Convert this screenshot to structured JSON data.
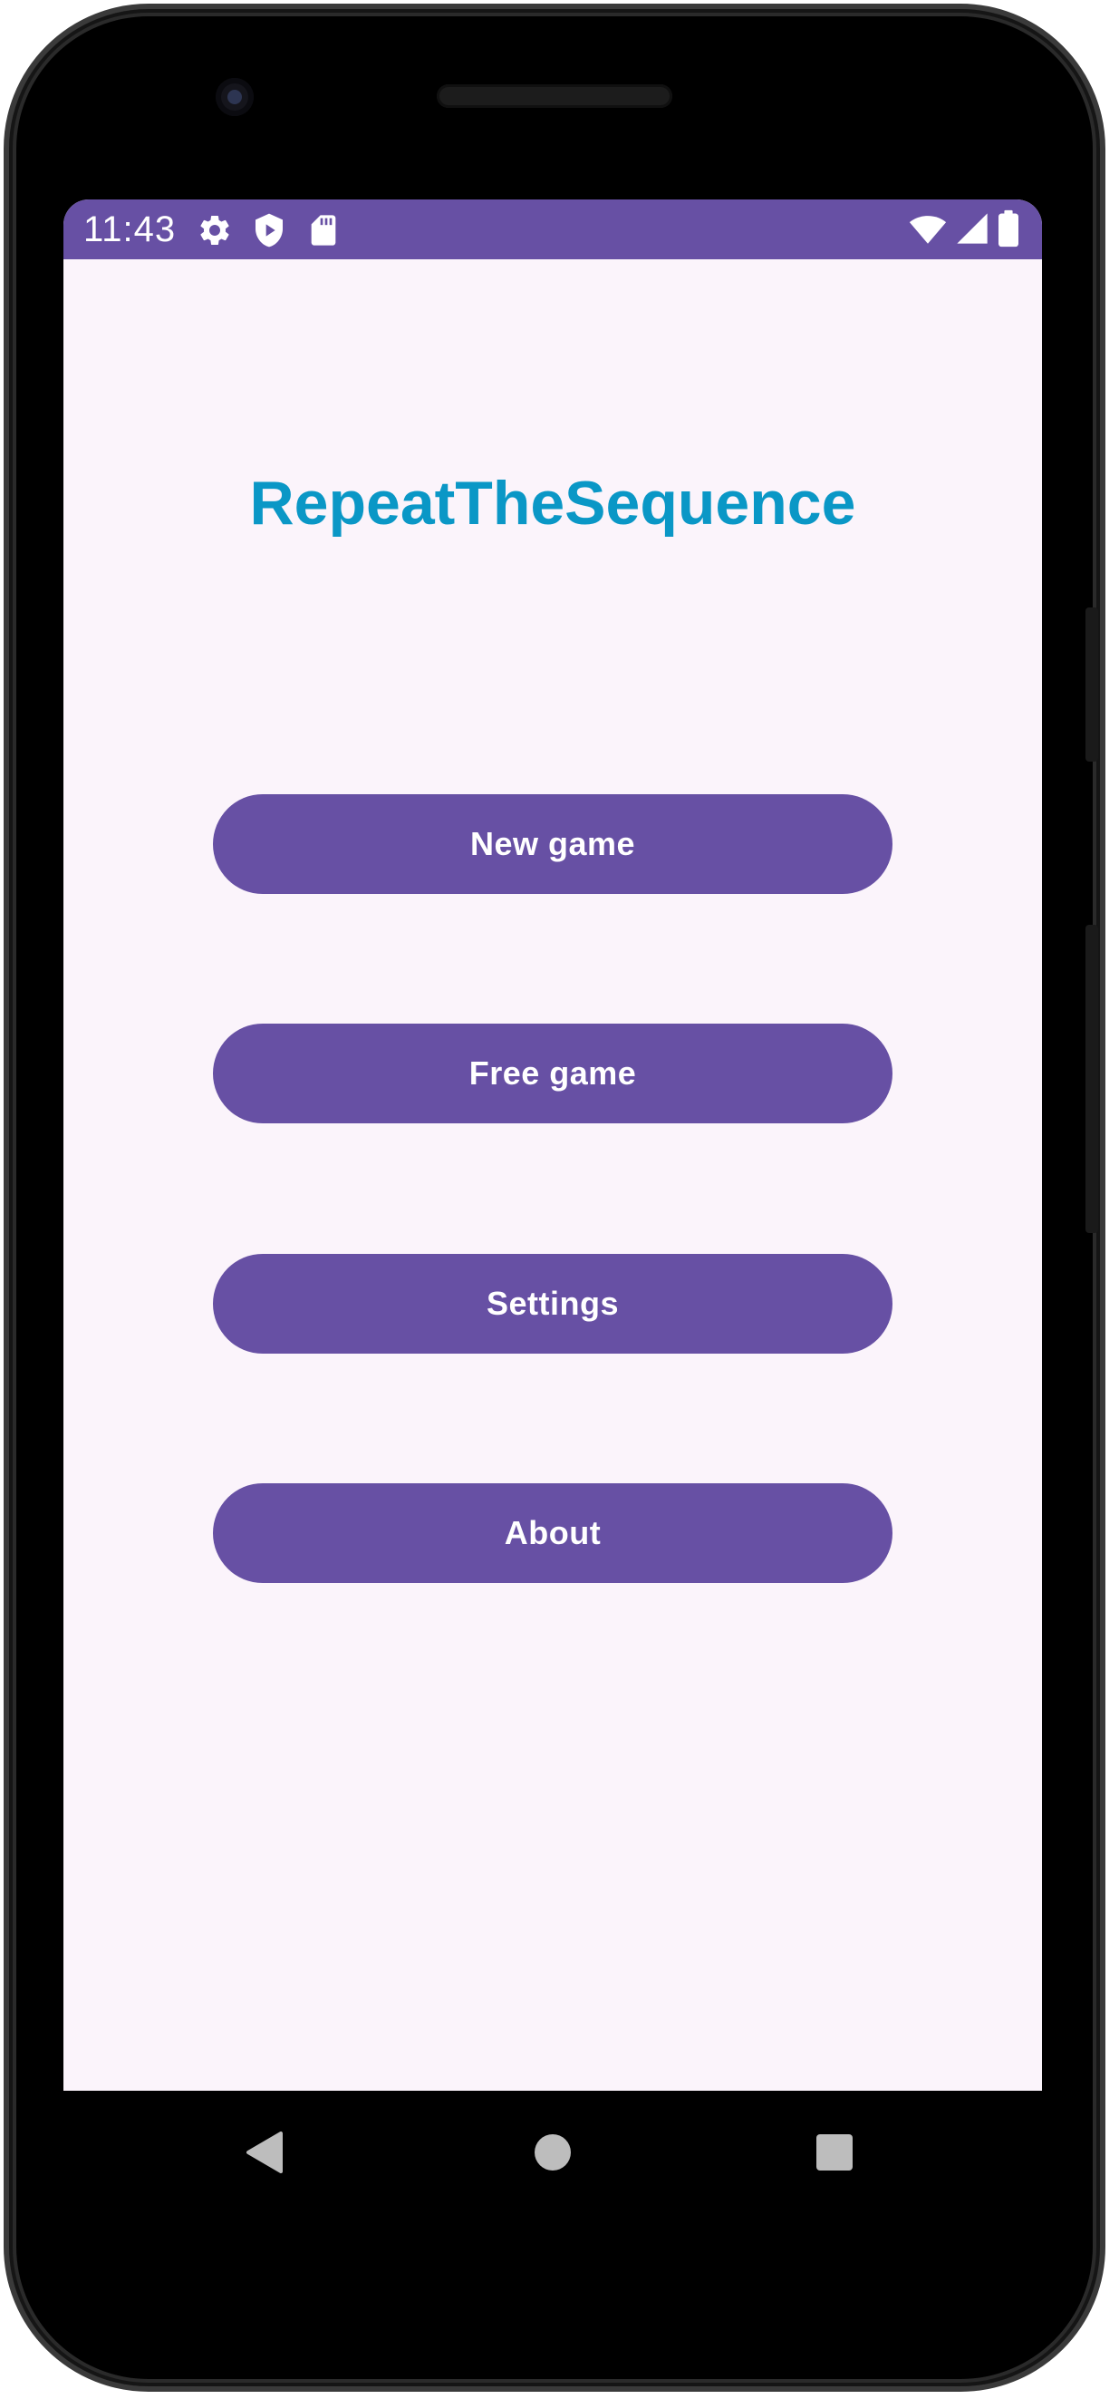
{
  "status_bar": {
    "time": "11:43",
    "icons": [
      "gear-icon",
      "shield-play-icon",
      "sd-card-icon",
      "wifi-icon",
      "signal-icon",
      "battery-icon"
    ],
    "background_color": "#6750a4"
  },
  "app": {
    "title": "RepeatTheSequence",
    "title_color": "#0a97c6",
    "background_color": "#fbf4fb",
    "accent_color": "#6750a4"
  },
  "menu": {
    "new_game": "New game",
    "free_game": "Free game",
    "settings": "Settings",
    "about": "About"
  },
  "nav_bar": {
    "icons": [
      "back-icon",
      "home-icon",
      "recents-icon"
    ]
  }
}
